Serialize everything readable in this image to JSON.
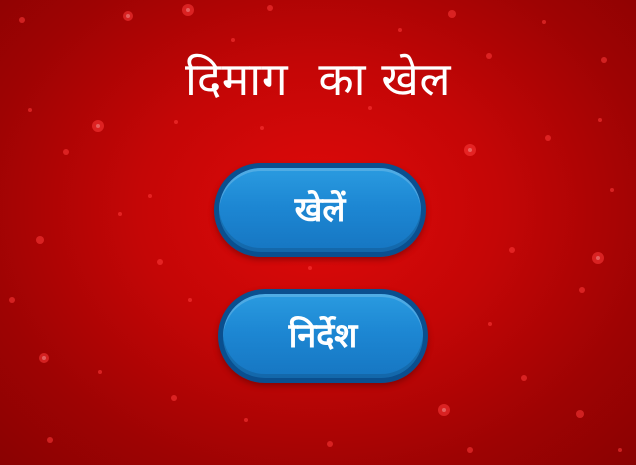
{
  "game": {
    "title": "दिमाग  का खेल"
  },
  "menu": {
    "play_label": "खेलें",
    "instructions_label": "निर्देश"
  },
  "colors": {
    "background": "#c40606",
    "button_fill": "#1d87d3",
    "button_border": "#0a4f8f",
    "text": "#ffffff"
  }
}
